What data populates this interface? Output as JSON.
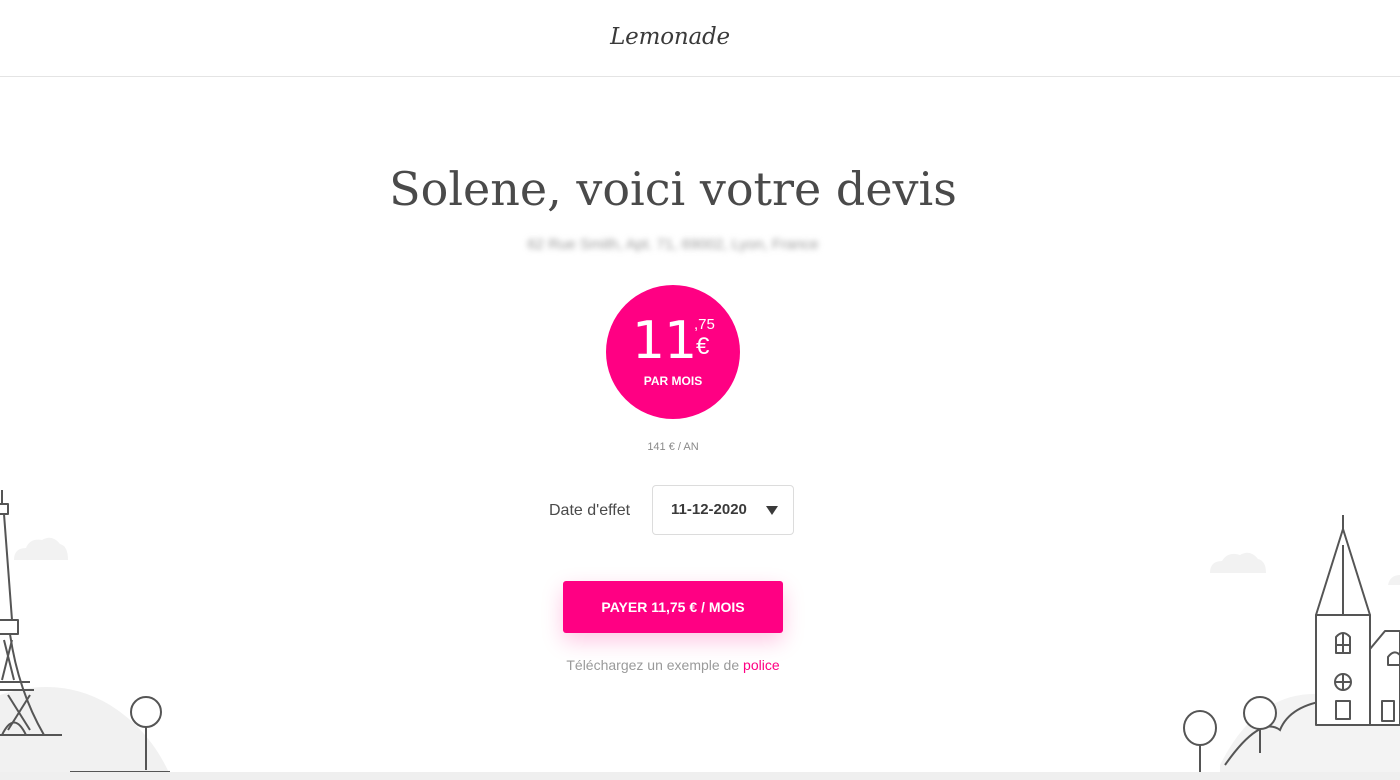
{
  "header": {
    "logo_text": "Lemonade"
  },
  "quote": {
    "title": "Solene, voici votre devis",
    "address": "62 Rue Smith, Apt. 71, 69002, Lyon, France"
  },
  "price": {
    "integer": "11",
    "decimals": ",75",
    "currency": "€",
    "period": "PAR MOIS",
    "yearly": "141 € / AN"
  },
  "effective_date": {
    "label": "Date d'effet",
    "value": "11-12-2020"
  },
  "cta": {
    "pay_label": "PAYER 11,75 € / MOIS"
  },
  "sample_policy": {
    "prefix": "Téléchargez un exemple de ",
    "link": "police"
  },
  "colors": {
    "brand_pink": "#ff0083",
    "text_dark": "#4a4a4a",
    "line_gray": "#555555"
  },
  "icons": [
    "eiffel-tower-icon",
    "tree-icon",
    "church-icon",
    "cloud-icon",
    "caret-down-icon"
  ]
}
